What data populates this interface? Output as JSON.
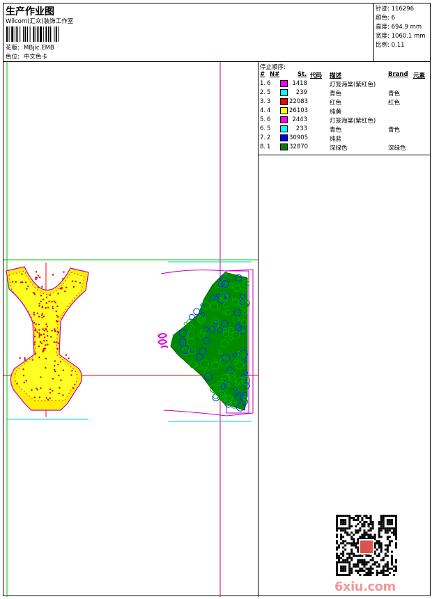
{
  "header": {
    "title": "生产作业图",
    "company": "Wilcom(汇众)装饰工作室",
    "pattern_label": "花版:",
    "pattern_value": "MBjic.EMB",
    "color_pos_label": "色位:",
    "color_pos_value": "中文色卡"
  },
  "stats": [
    {
      "label": "针迹:",
      "value": "116296"
    },
    {
      "label": "颜色:",
      "value": "6"
    },
    {
      "label": "高度:",
      "value": "694.9 mm"
    },
    {
      "label": "宽度:",
      "value": "1060.1 mm"
    },
    {
      "label": "比例:",
      "value": "0.11"
    }
  ],
  "stop_sequence": {
    "title": "停止顺序:",
    "columns": {
      "num": "#",
      "n": "N#",
      "st": "St.",
      "code": "代码",
      "desc": "描述",
      "brand": "Brand",
      "element": "元素"
    },
    "rows": [
      {
        "num": "1.",
        "n": "6",
        "color": "#ff00ff",
        "st": "1418",
        "desc": "灯笼海棠(紫红色)",
        "brand": ""
      },
      {
        "num": "2.",
        "n": "5",
        "color": "#00ffff",
        "st": "239",
        "desc": "青色",
        "brand": "青色"
      },
      {
        "num": "3.",
        "n": "3",
        "color": "#ff0000",
        "st": "22083",
        "desc": "红色",
        "brand": "红色"
      },
      {
        "num": "4.",
        "n": "4",
        "color": "#ffff00",
        "st": "26103",
        "desc": "纯黄",
        "brand": ""
      },
      {
        "num": "5.",
        "n": "6",
        "color": "#ff00ff",
        "st": "2443",
        "desc": "灯笼海棠(紫红色)",
        "brand": ""
      },
      {
        "num": "6.",
        "n": "5",
        "color": "#00ffff",
        "st": "233",
        "desc": "青色",
        "brand": "青色"
      },
      {
        "num": "7.",
        "n": "2",
        "color": "#0000ff",
        "st": "30905",
        "desc": "纯蓝",
        "brand": ""
      },
      {
        "num": "8.",
        "n": "1",
        "color": "#008000",
        "st": "32870",
        "desc": "深绿色",
        "brand": "深绿色"
      }
    ]
  },
  "watermark": {
    "site": "6xiu.com"
  }
}
